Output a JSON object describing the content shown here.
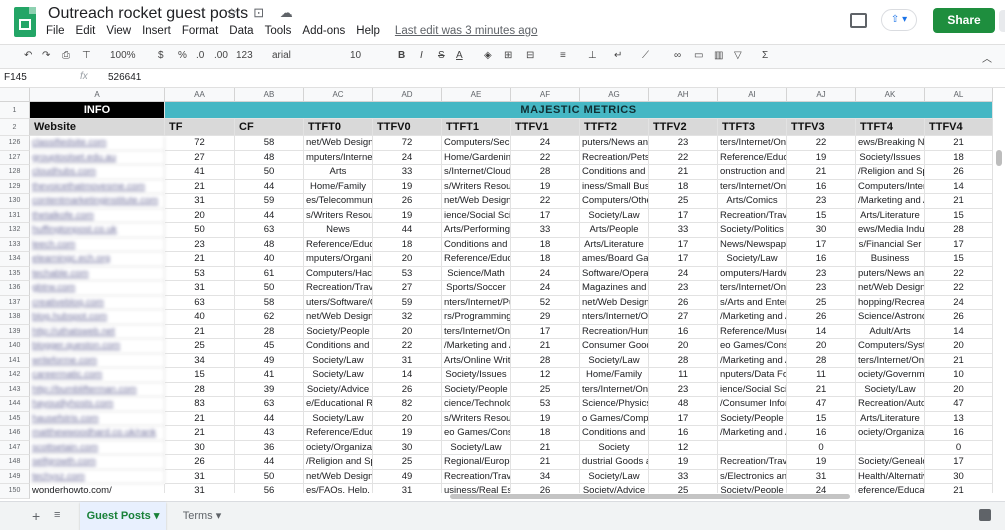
{
  "app": {
    "title": "Outreach rocket guest posts",
    "menus": [
      "File",
      "Edit",
      "View",
      "Insert",
      "Format",
      "Data",
      "Tools",
      "Add-ons",
      "Help"
    ],
    "last_edit": "Last edit was 3 minutes ago",
    "share_label": "Share",
    "present_label": "⇧ ▾"
  },
  "toolbar": {
    "zoom": "100%",
    "currency": "$",
    "percent": "%",
    "dec_less": ".0",
    "dec_more": ".00",
    "number_format": "123",
    "font": "arial",
    "font_size": "10",
    "bold": "B",
    "italic": "I",
    "strike": "S",
    "text_color": "A"
  },
  "formula_bar": {
    "cell_ref": "F145",
    "fx": "fx",
    "value": "526641"
  },
  "columns": [
    "A",
    "AA",
    "AB",
    "AC",
    "AD",
    "AE",
    "AF",
    "AG",
    "AH",
    "AI",
    "AJ",
    "AK",
    "AL"
  ],
  "header_rows": {
    "row1_info": "INFO",
    "row1_majestic": "MAJESTIC METRICS",
    "row2": [
      "Website",
      "TF",
      "CF",
      "TTFT0",
      "TTFV0",
      "TTFT1",
      "TTFV1",
      "TTFT2",
      "TTFV2",
      "TTFT3",
      "TTFV3",
      "TTFT4",
      "TTFV4"
    ]
  },
  "row_numbers": [
    "1",
    "2",
    "126",
    "127",
    "128",
    "129",
    "130",
    "131",
    "132",
    "133",
    "134",
    "135",
    "136",
    "137",
    "138",
    "139",
    "140",
    "141",
    "142",
    "143",
    "144",
    "145",
    "146",
    "147",
    "148",
    "149",
    "150"
  ],
  "rows": [
    [
      "classifiedsite.com",
      "72",
      "58",
      "net/Web Design a",
      "72",
      "Computers/Securit",
      "24",
      "puters/News and I",
      "23",
      "ters/Internet/On th",
      "22",
      "ews/Breaking New",
      "21"
    ],
    [
      "grouptoolset.edu.au",
      "27",
      "48",
      "mputers/Internet/E",
      "24",
      "Home/Gardening",
      "22",
      "Recreation/Pets",
      "22",
      "Reference/Educatio",
      "19",
      "Society/Issues",
      "18"
    ],
    [
      "cloudhubs.com",
      "41",
      "50",
      "Arts",
      "33",
      "s/Internet/Cloud C",
      "28",
      "Conditions and D",
      "21",
      "onstruction and M",
      "21",
      "/Religion and Spi",
      "26"
    ],
    [
      "thevoicethatmovesme.com",
      "21",
      "44",
      "Home/Family",
      "19",
      "s/Writers Resour",
      "19",
      "iness/Small Busin",
      "18",
      "ters/Internet/On th",
      "16",
      "Computers/Interne",
      "14"
    ],
    [
      "contentmarketinginstitute.com",
      "31",
      "59",
      "es/Telecommunic",
      "26",
      "net/Web Design a",
      "22",
      "Computers/Other",
      "25",
      "Arts/Comics",
      "23",
      "/Marketing and Ad",
      "21"
    ],
    [
      "thetalkofe.com",
      "20",
      "44",
      "s/Writers Resour",
      "19",
      "ience/Social Scien",
      "17",
      "Society/Law",
      "17",
      "Recreation/Trave",
      "15",
      "Arts/Literature",
      "15"
    ],
    [
      "huffingtonpost.co.uk",
      "50",
      "63",
      "News",
      "44",
      "Arts/Performing Ar",
      "33",
      "Arts/People",
      "33",
      "Society/Politics",
      "30",
      "ews/Media Indust",
      "28"
    ],
    [
      "leech.com",
      "23",
      "48",
      "Reference/Educatio",
      "18",
      "Conditions and D",
      "18",
      "Arts/Literature",
      "17",
      "News/Newspapers",
      "17",
      "s/Financial Ser",
      "17"
    ],
    [
      "elearningc.ech.org",
      "21",
      "40",
      "mputers/Organizat",
      "20",
      "Reference/Educatio",
      "18",
      "ames/Board Gam",
      "17",
      "Society/Law",
      "16",
      "Business",
      "15"
    ],
    [
      "techable.com",
      "53",
      "61",
      "Computers/Hackin",
      "53",
      "Science/Math",
      "24",
      "Software/Operati",
      "24",
      "omputers/Hardwa",
      "23",
      "puters/News and I",
      "22"
    ],
    [
      "gbtrw.com",
      "31",
      "50",
      "Recreation/Trave",
      "27",
      "Sports/Soccer",
      "24",
      "Magazines and E",
      "23",
      "ters/Internet/On th",
      "23",
      "net/Web Design a",
      "22"
    ],
    [
      "creativebloq.com",
      "63",
      "58",
      "uters/Software/Gr",
      "59",
      "nters/Internet/Publ",
      "52",
      "net/Web Design a",
      "26",
      "s/Arts and Entert",
      "25",
      "hopping/Recreatio",
      "24"
    ],
    [
      "blog.hubspot.com",
      "40",
      "62",
      "net/Web Design a",
      "32",
      "rs/Programming/L",
      "29",
      "nters/Internet/On t",
      "27",
      "/Marketing and Ad",
      "26",
      "Science/Astronom",
      "26"
    ],
    [
      "http://uthatsweb.net",
      "21",
      "28",
      "Society/People",
      "20",
      "ters/Internet/On th",
      "17",
      "Recreation/Humo",
      "16",
      "Reference/Museum",
      "14",
      "Adult/Arts",
      "14"
    ],
    [
      "blogger.queston.com",
      "25",
      "45",
      "Conditions and D",
      "22",
      "/Marketing and Ad",
      "21",
      "Consumer Goods a",
      "20",
      "eo Games/Conso",
      "20",
      "Computers/System",
      "20"
    ],
    [
      "writeforme.com",
      "34",
      "49",
      "Society/Law",
      "31",
      "Arts/Online Writing",
      "28",
      "Society/Law",
      "28",
      "/Marketing and Ad",
      "28",
      "ters/Internet/On th",
      "21"
    ],
    [
      "careermatic.com",
      "15",
      "41",
      "Society/Law",
      "14",
      "Society/Issues",
      "12",
      "Home/Family",
      "11",
      "nputers/Data Form",
      "11",
      "ociety/Governme",
      "10"
    ],
    [
      "http://bumblifterman.com",
      "28",
      "39",
      "Society/Advice",
      "26",
      "Society/People",
      "25",
      "ters/Internet/On th",
      "23",
      "ience/Social Scien",
      "21",
      "Society/Law",
      "20"
    ],
    [
      "hayoudlyhosts.com",
      "83",
      "63",
      "e/Educational Res",
      "82",
      "cience/Technolog",
      "53",
      "Science/Physics",
      "48",
      "/Consumer Inform",
      "47",
      "Recreation/Autos",
      "47"
    ],
    [
      "hausefstris.com",
      "21",
      "44",
      "Society/Law",
      "20",
      "s/Writers Resour",
      "19",
      "o Games/Comput",
      "17",
      "Society/People",
      "15",
      "Arts/Literature",
      "13"
    ],
    [
      "matthewwoodhard.co.uk/rank",
      "21",
      "43",
      "Reference/Educatio",
      "19",
      "eo Games/Conso",
      "18",
      "Conditions and D",
      "16",
      "/Marketing and Ad",
      "16",
      "ociety/Organizatio",
      "16"
    ],
    [
      "scottsetain.com",
      "30",
      "36",
      "ociety/Organizatio",
      "30",
      "Society/Law",
      "21",
      "Society",
      "12",
      "",
      "0",
      "",
      "0"
    ],
    [
      "selfgrowth.com",
      "26",
      "44",
      "/Religion and Spi",
      "25",
      "Regional/Europe",
      "21",
      "dustrial Goods ar",
      "19",
      "Recreation/Travel",
      "19",
      "Society/Genealog",
      "17"
    ],
    [
      "techyxz.com",
      "31",
      "50",
      "net/Web Design a",
      "49",
      "Recreation/Trave",
      "34",
      "Society/Law",
      "33",
      "s/Electronics and",
      "31",
      "Health/Alternative",
      "30"
    ],
    [
      "wonderhowto.com/",
      "31",
      "56",
      "es/FAQs, Help, an",
      "31",
      "usiness/Real Esta",
      "26",
      "Society/Advice",
      "25",
      "Society/People",
      "24",
      "eference/Educatio",
      "21"
    ]
  ],
  "sheet_tabs": {
    "active": "Guest Posts ▾",
    "inactive": "Terms ▾"
  }
}
